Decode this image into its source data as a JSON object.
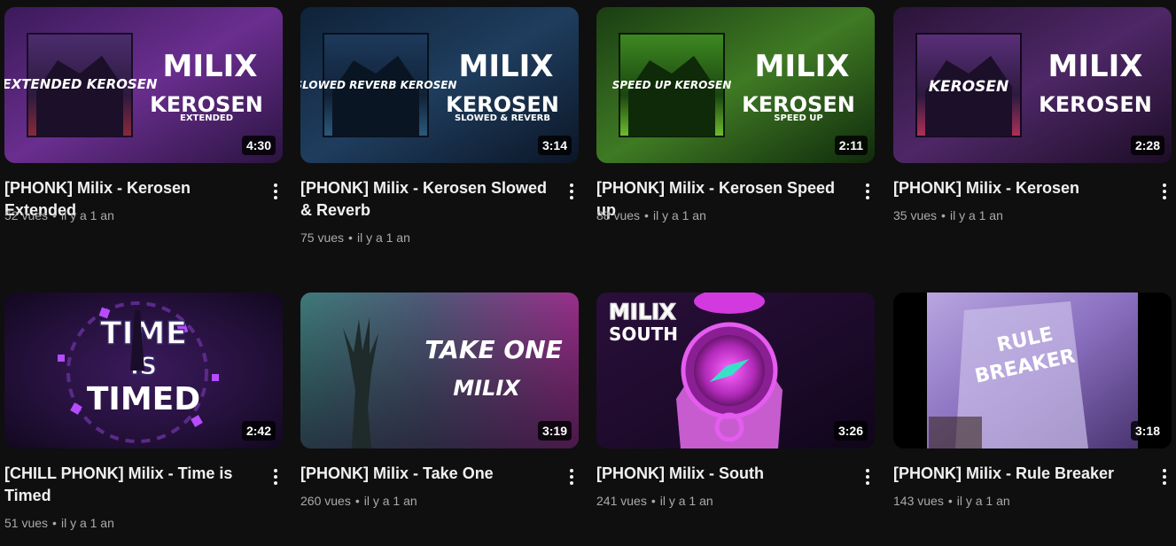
{
  "videos": [
    {
      "title": "[PHONK] Milix - Kerosen Extended",
      "views": "52 vues",
      "age": "il y a 1 an",
      "duration": "4:30",
      "art": {
        "cover": "EXTENDED KEROSEN",
        "headline": "MILIX",
        "sub1": "KEROSEN",
        "sub2": "EXTENDED"
      }
    },
    {
      "title": "[PHONK] Milix - Kerosen Slowed & Reverb",
      "views": "75 vues",
      "age": "il y a 1 an",
      "duration": "3:14",
      "art": {
        "cover": "SLOWED REVERB KEROSEN",
        "headline": "MILIX",
        "sub1": "KEROSEN",
        "sub2": "SLOWED & REVERB"
      }
    },
    {
      "title": "[PHONK] Milix - Kerosen Speed up",
      "views": "88 vues",
      "age": "il y a 1 an",
      "duration": "2:11",
      "art": {
        "cover": "SPEED UP KEROSEN",
        "headline": "MILIX",
        "sub1": "KEROSEN",
        "sub2": "SPEED UP"
      }
    },
    {
      "title": "[PHONK] Milix - Kerosen",
      "views": "35 vues",
      "age": "il y a 1 an",
      "duration": "2:28",
      "art": {
        "cover": "KEROSEN",
        "headline": "MILIX",
        "sub1": "KEROSEN",
        "sub2": ""
      }
    },
    {
      "title": "[CHILL PHONK] Milix - Time is Timed",
      "views": "51 vues",
      "age": "il y a 1 an",
      "duration": "2:42",
      "art": {
        "line1": "TIME",
        "line2": "IS",
        "line3": "TIMED"
      }
    },
    {
      "title": "[PHONK] Milix - Take One",
      "views": "260 vues",
      "age": "il y a 1 an",
      "duration": "3:19",
      "art": {
        "line1": "TAKE ONE",
        "line2": "MILIX"
      }
    },
    {
      "title": "[PHONK] Milix - South",
      "views": "241 vues",
      "age": "il y a 1 an",
      "duration": "3:26",
      "art": {
        "line1": "MILIX",
        "line2": "SOUTH"
      }
    },
    {
      "title": "[PHONK] Milix - Rule Breaker",
      "views": "143 vues",
      "age": "il y a 1 an",
      "duration": "3:18",
      "art": {
        "line1": "RULE",
        "line2": "BREAKER"
      }
    }
  ],
  "meta_separator": "•",
  "colors": {
    "background": "#0f0f0f",
    "title": "#f1f1f1",
    "meta": "#aaaaaa"
  }
}
